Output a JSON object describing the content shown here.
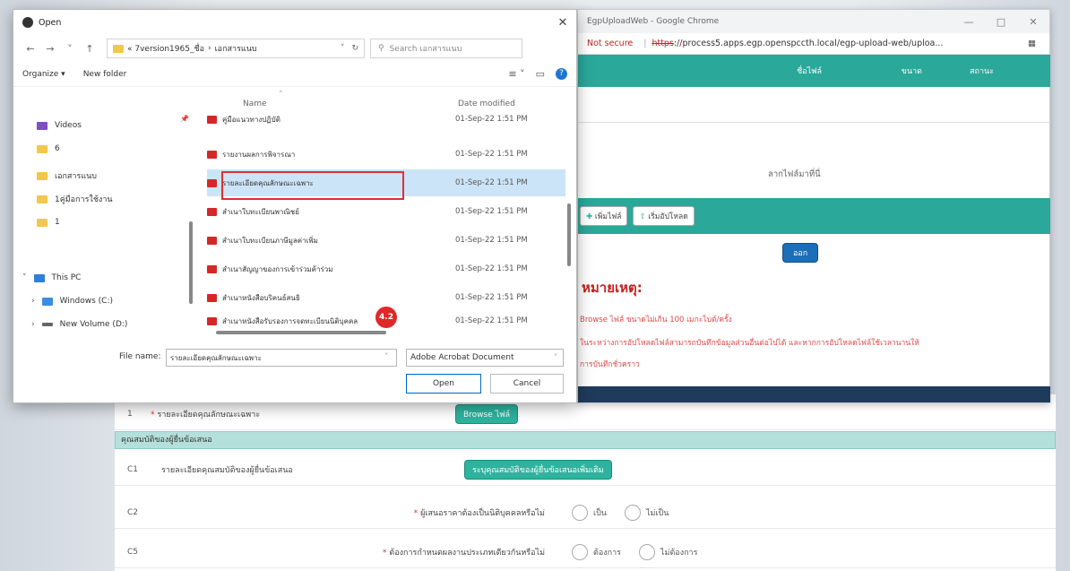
{
  "dialog": {
    "title": "Open",
    "breadcrumb": [
      "« 7version1965_ชื่อ",
      "›",
      "เอกสารแนบ"
    ],
    "search_placeholder": "Search เอกสารแนบ",
    "organize_label": "Organize ▾",
    "new_folder_label": "New folder",
    "nav_items": [
      "Videos",
      "6",
      "เอกสารแนบ",
      "1คู่มือการใช้งาน",
      "1",
      "This PC",
      "Windows (C:)",
      "New Volume (D:)"
    ],
    "columns": {
      "name": "Name",
      "date": "Date modified"
    },
    "files": [
      {
        "name": "คู่มือแนวทางปฏิบัติ",
        "date": "01-Sep-22 1:51 PM"
      },
      {
        "name": "รายงานผลการพิจารณา",
        "date": "01-Sep-22 1:51 PM"
      },
      {
        "name": "รายละเอียดคุณลักษณะเฉพาะ",
        "date": "01-Sep-22 1:51 PM"
      },
      {
        "name": "สำเนาใบทะเบียนพาณิชย์",
        "date": "01-Sep-22 1:51 PM"
      },
      {
        "name": "สำเนาใบทะเบียนภาษีมูลค่าเพิ่ม",
        "date": "01-Sep-22 1:51 PM"
      },
      {
        "name": "สำเนาสัญญาของการเข้าร่วมค้าร่วม",
        "date": "01-Sep-22 1:51 PM"
      },
      {
        "name": "สำเนาหนังสือบริคนธ์สนธิ",
        "date": "01-Sep-22 1:51 PM"
      },
      {
        "name": "สำเนาหนังสือรับรองการจดทะเบียนนิติบุคคล",
        "date": "01-Sep-22 1:51 PM"
      }
    ],
    "step_badge": "4.2",
    "file_name_label": "File name:",
    "file_name_value": "รายละเอียดคุณลักษณะเฉพาะ",
    "file_type": "Adobe Acrobat Document",
    "open_label": "Open",
    "cancel_label": "Cancel"
  },
  "chrome": {
    "title": "EgpUploadWeb - Google Chrome",
    "not_secure": "Not secure",
    "url_scheme": "https",
    "url_rest": "://process5.apps.egp.openspccth.local/egp-upload-web/uploa...",
    "table_headers": [
      "ชื่อไฟล์",
      "ขนาด",
      "สถานะ"
    ],
    "drop_text": "ลากไฟล์มาที่นี่",
    "add_file": "เพิ่มไฟล์",
    "start_upload": "เริ่มอัปโหลด",
    "exit_label": "ออก",
    "remark_title": "หมายเหตุ:",
    "remark_lines": [
      "Browse ไฟล์ ขนาดไม่เกิน 100 เมกะไบต์/ครั้ง",
      "ในระหว่างการอัปโหลดไฟล์สามารถบันทึกข้อมูลส่วนอื่นต่อไปได้ และหากการอัปโหลดไฟล์ใช้เวลานานให้",
      "การบันทึกชั่วคราว"
    ]
  },
  "form": {
    "row1_num": "1",
    "row1_label": "รายละเอียดคุณลักษณะเฉพาะ",
    "browse_label": "Browse ไฟล์",
    "section_title": "คุณสมบัติของผู้ยื่นข้อเสนอ",
    "c1_num": "C1",
    "c1_label": "รายละเอียดคุณสมบัติของผู้ยื่นข้อเสนอ",
    "c1_button": "ระบุคุณสมบัติของผู้ยื่นข้อเสนอเพิ่มเติม",
    "c2_num": "C2",
    "c2_label": "ผู้เสนอราคาต้องเป็นนิติบุคคลหรือไม่",
    "c2_yes": "เป็น",
    "c2_no": "ไม่เป็น",
    "c5_num": "C5",
    "c5_label": "ต้องการกำหนดผลงานประเภทเดียวกันหรือไม่",
    "c5_yes": "ต้องการ",
    "c5_no": "ไม่ต้องการ"
  }
}
